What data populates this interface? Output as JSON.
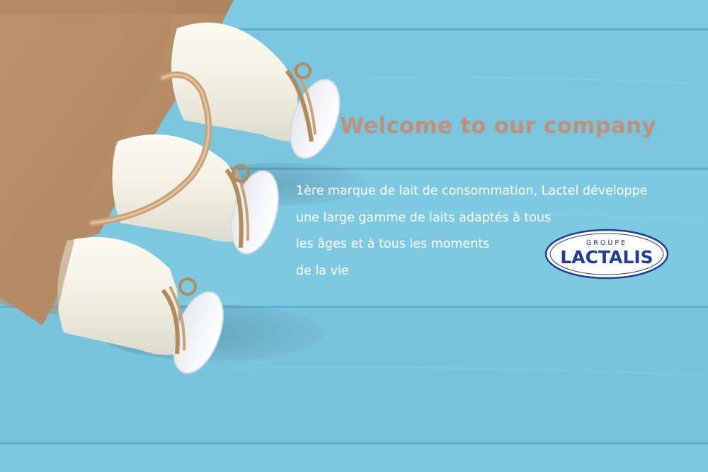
{
  "headline": "Welcome to our company",
  "body_lines": [
    "1ère marque de lait de consommation, Lactel développe",
    "une large gamme de laits adaptés à tous",
    "les âges et à tous les moments",
    "de la vie"
  ],
  "logo": {
    "top_text": "GROUPE",
    "main_text": "LACTALIS"
  },
  "colors": {
    "background": "#7cc8e0",
    "headline": "#c0907a",
    "body_text": "#ffffff",
    "logo_blue": "#1f3f90",
    "paper_bag": "#b48a62"
  },
  "icons": [
    "milk-bottle-icon",
    "paper-bag-icon",
    "lactalis-logo-icon"
  ]
}
